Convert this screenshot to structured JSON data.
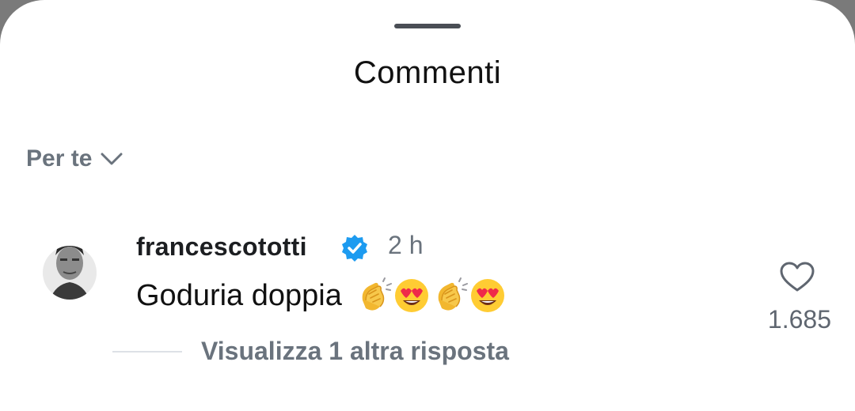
{
  "sheet": {
    "title": "Commenti"
  },
  "sort": {
    "label": "Per te",
    "icon": "chevron-down-icon"
  },
  "comment": {
    "username": "francescototti",
    "verified": true,
    "time": "2 h",
    "text": "Goduria doppia",
    "emojis": [
      "clapping-hands-icon",
      "heart-eyes-icon",
      "clapping-hands-icon",
      "heart-eyes-icon"
    ],
    "like_count": "1.685",
    "view_replies": "Visualizza 1 altra risposta"
  },
  "colors": {
    "verified_badge": "#1d9bf0",
    "muted_text": "#6a737d"
  }
}
